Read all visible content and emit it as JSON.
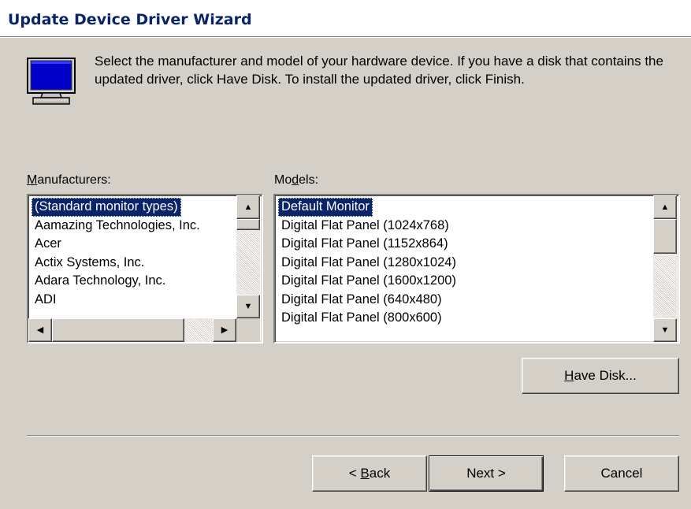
{
  "window": {
    "title": "Update Device Driver Wizard"
  },
  "instruction": "Select the manufacturer and model of your hardware device. If you have a disk that contains the updated driver, click Have Disk. To install the updated driver, click Finish.",
  "manufacturers": {
    "label_accel": "M",
    "label_rest": "anufacturers:",
    "items": [
      "(Standard monitor types)",
      "Aamazing Technologies, Inc.",
      "Acer",
      "Actix Systems, Inc.",
      "Adara Technology, Inc.",
      "ADI"
    ],
    "selected_index": 0
  },
  "models": {
    "label_pre": "Mo",
    "label_accel": "d",
    "label_post": "els:",
    "items": [
      "Default Monitor",
      "Digital Flat Panel (1024x768)",
      "Digital Flat Panel (1152x864)",
      "Digital Flat Panel (1280x1024)",
      "Digital Flat Panel (1600x1200)",
      "Digital Flat Panel (640x480)",
      "Digital Flat Panel (800x600)"
    ],
    "selected_index": 0
  },
  "buttons": {
    "have_disk_accel": "H",
    "have_disk_rest": "ave Disk...",
    "back_prefix": "< ",
    "back_accel": "B",
    "back_rest": "ack",
    "next": "Next >",
    "cancel": "Cancel"
  },
  "icons": {
    "monitor": "monitor-icon",
    "scroll_up": "arrow-up-icon",
    "scroll_down": "arrow-down-icon",
    "scroll_left": "arrow-left-icon",
    "scroll_right": "arrow-right-icon"
  },
  "colors": {
    "selection": "#0a246a",
    "title_text": "#0a246a",
    "face": "#d4d0c8"
  }
}
